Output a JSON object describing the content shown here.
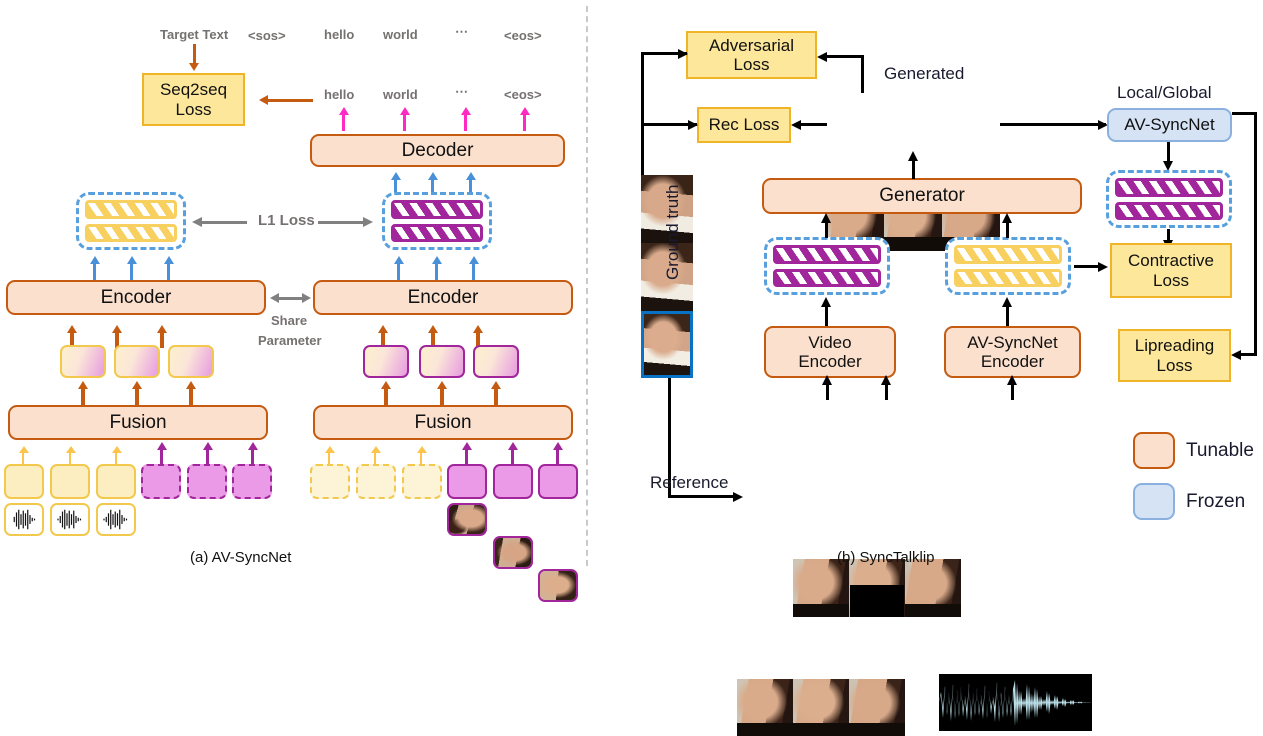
{
  "figure": {
    "panel_a_caption": "(a) AV-SyncNet",
    "panel_b_caption": "(b) SyncTalklip"
  },
  "panel_a": {
    "target_text_label": "Target Text",
    "target_tokens": [
      "<sos>",
      "hello",
      "world",
      "⋯",
      "<eos>"
    ],
    "output_tokens": [
      "hello",
      "world",
      "⋯",
      "<eos>"
    ],
    "seq2seq_loss": "Seq2seq\nLoss",
    "seq2seq_loss_line1": "Seq2seq",
    "seq2seq_loss_line2": "Loss",
    "decoder": "Decoder",
    "l1_loss": "L1 Loss",
    "encoder_left": "Encoder",
    "encoder_right": "Encoder",
    "share_line1": "Share",
    "share_line2": "Parameter",
    "fusion_left": "Fusion",
    "fusion_right": "Fusion"
  },
  "panel_b": {
    "adversarial_loss_line1": "Adversarial",
    "adversarial_loss_line2": "Loss",
    "rec_loss": "Rec Loss",
    "generated_label": "Generated",
    "local_global_label": "Local/Global",
    "av_syncnet": "AV-SyncNet",
    "contractive_loss_line1": "Contractive",
    "contractive_loss_line2": "Loss",
    "lipreading_loss_line1": "Lipreading",
    "lipreading_loss_line2": "Loss",
    "generator": "Generator",
    "video_encoder_line1": "Video",
    "video_encoder_line2": "Encoder",
    "avsyncnet_encoder_line1": "AV-SyncNet",
    "avsyncnet_encoder_line2": "Encoder",
    "ground_truth_label": "Ground truth",
    "reference_label": "Reference",
    "legend": {
      "tunable": "Tunable",
      "frozen": "Frozen"
    }
  },
  "colors": {
    "tunable_fill": "#fbe0cd",
    "tunable_border": "#c55a11",
    "frozen_fill": "#d6e3f5",
    "frozen_border": "#8ab0e0",
    "loss_fill": "#fde79a",
    "loss_border": "#f0b429",
    "purple": "#a2269b",
    "yellow": "#f2c94c",
    "blue_arrow": "#4a90d9",
    "pink_arrow": "#ff29c3",
    "gray_text": "#767171",
    "waveform": "#b9dde6",
    "highlight_border": "#0a72c4"
  }
}
